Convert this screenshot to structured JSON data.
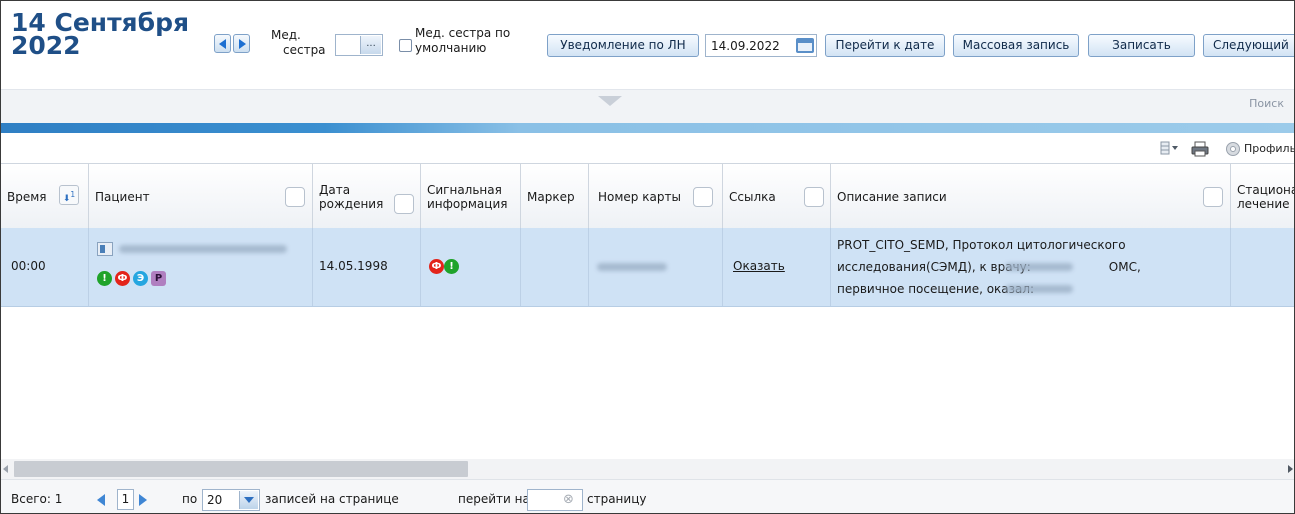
{
  "header": {
    "date_line1": "14 Сентября",
    "date_line2": "2022",
    "nurse_label_1": "Мед.",
    "nurse_label_2": "сестра",
    "picker_dots": "...",
    "default_nurse_label_1": "Мед. сестра по",
    "default_nurse_label_2": "умолчанию",
    "btn_notify": "Уведомление по ЛН",
    "date_value": "14.09.2022",
    "btn_goto_date": "Перейти к дате",
    "btn_mass": "Массовая запись",
    "btn_record": "Записать",
    "btn_next": "Следующий"
  },
  "search": {
    "label": "Поиск"
  },
  "toolbar": {
    "profile_label": "Профиль"
  },
  "table": {
    "columns": {
      "time": "Время",
      "sort_mark": "1",
      "patient": "Пациент",
      "dob_1": "Дата",
      "dob_2": "рождения",
      "signal_1": "Сигнальная",
      "signal_2": "информация",
      "marker": "Маркер",
      "card": "Номер карты",
      "link": "Ссылка",
      "description": "Описание записи",
      "inpatient_1": "Стационарное",
      "inpatient_2": "лечение"
    },
    "rows": [
      {
        "time": "00:00",
        "dob": "14.05.1998",
        "link": "Оказать",
        "desc_1": "PROT_CITO_SEMD, Протокол цитологического",
        "desc_2": "исследования(СЭМД), к врачу:",
        "desc_2b": "ОМС,",
        "desc_3": "первичное посещение, оказал:",
        "badges": [
          "!",
          "Ф",
          "Э",
          "Р"
        ],
        "signal_badges": [
          "Ф",
          "!"
        ]
      }
    ]
  },
  "footer": {
    "total": "Всего: 1",
    "page": "1",
    "per_prefix": "по",
    "per_value": "20",
    "per_suffix": "записей на странице",
    "goto_prefix": "перейти на",
    "goto_suffix": "страницу",
    "clear_icon": "⊗"
  },
  "colors": {
    "accent": "#1f4f87",
    "row_selected": "#cfe2f5",
    "badge_green": "#1fa32a",
    "badge_red": "#e3241b",
    "badge_blue": "#25a6e0",
    "badge_purple": "#b07fc0"
  }
}
